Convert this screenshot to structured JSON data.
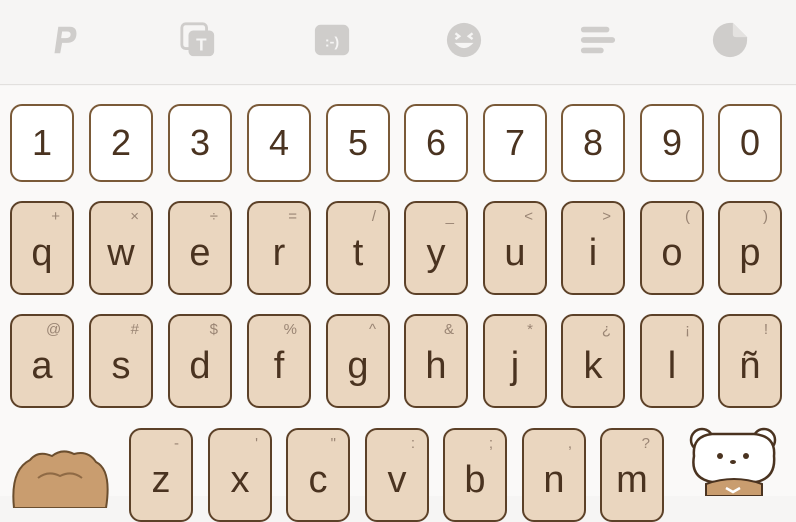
{
  "toolbar": {
    "icons": [
      "paypal-icon",
      "text-box-icon",
      "emoticon-icon",
      "emoji-icon",
      "menu-icon",
      "sticker-icon"
    ],
    "emoticon_text": ":-)",
    "text_box_letter": "T"
  },
  "keyboard": {
    "numbers": [
      "1",
      "2",
      "3",
      "4",
      "5",
      "6",
      "7",
      "8",
      "9",
      "0"
    ],
    "row1": [
      {
        "key": "q",
        "alt": "+"
      },
      {
        "key": "w",
        "alt": "×"
      },
      {
        "key": "e",
        "alt": "÷"
      },
      {
        "key": "r",
        "alt": "="
      },
      {
        "key": "t",
        "alt": "/"
      },
      {
        "key": "y",
        "alt": "_"
      },
      {
        "key": "u",
        "alt": "<"
      },
      {
        "key": "i",
        "alt": ">"
      },
      {
        "key": "o",
        "alt": "("
      },
      {
        "key": "p",
        "alt": ")"
      }
    ],
    "row2": [
      {
        "key": "a",
        "alt": "@"
      },
      {
        "key": "s",
        "alt": "#"
      },
      {
        "key": "d",
        "alt": "$"
      },
      {
        "key": "f",
        "alt": "%"
      },
      {
        "key": "g",
        "alt": "^"
      },
      {
        "key": "h",
        "alt": "&"
      },
      {
        "key": "j",
        "alt": "*"
      },
      {
        "key": "k",
        "alt": "¿"
      },
      {
        "key": "l",
        "alt": "¡"
      },
      {
        "key": "ñ",
        "alt": "!"
      }
    ],
    "row3": [
      {
        "key": "z",
        "alt": "-"
      },
      {
        "key": "x",
        "alt": "'"
      },
      {
        "key": "c",
        "alt": "\""
      },
      {
        "key": "v",
        "alt": ":"
      },
      {
        "key": "b",
        "alt": ";"
      },
      {
        "key": "n",
        "alt": ","
      },
      {
        "key": "m",
        "alt": "?"
      }
    ]
  },
  "colors": {
    "key_fill": "#ead6bf",
    "key_border": "#5c4128",
    "number_fill": "#ffffff",
    "toolbar_icon": "#cfcdcb"
  }
}
